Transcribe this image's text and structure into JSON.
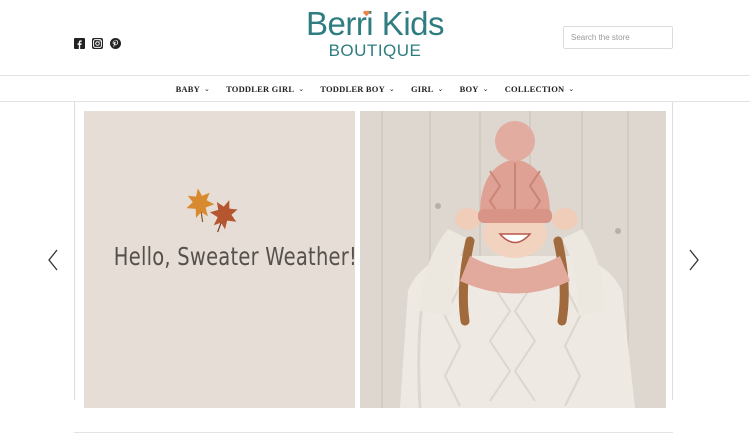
{
  "header": {
    "social": [
      {
        "icon": "facebook-icon"
      },
      {
        "icon": "instagram-icon"
      },
      {
        "icon": "pinterest-icon"
      }
    ],
    "logo": {
      "main": "Berri Kids",
      "sub": "BOUTIQUE",
      "color": "#2f7d80",
      "heart_color": "#e8834a"
    },
    "search": {
      "placeholder": "Search the store"
    }
  },
  "nav": {
    "items": [
      {
        "label": "BABY"
      },
      {
        "label": "TODDLER GIRL"
      },
      {
        "label": "TODDLER BOY"
      },
      {
        "label": "GIRL"
      },
      {
        "label": "BOY"
      },
      {
        "label": "COLLECTION"
      }
    ]
  },
  "carousel": {
    "headline": "Hello, Sweater Weather!",
    "left_bg": "#e6ddd6"
  }
}
